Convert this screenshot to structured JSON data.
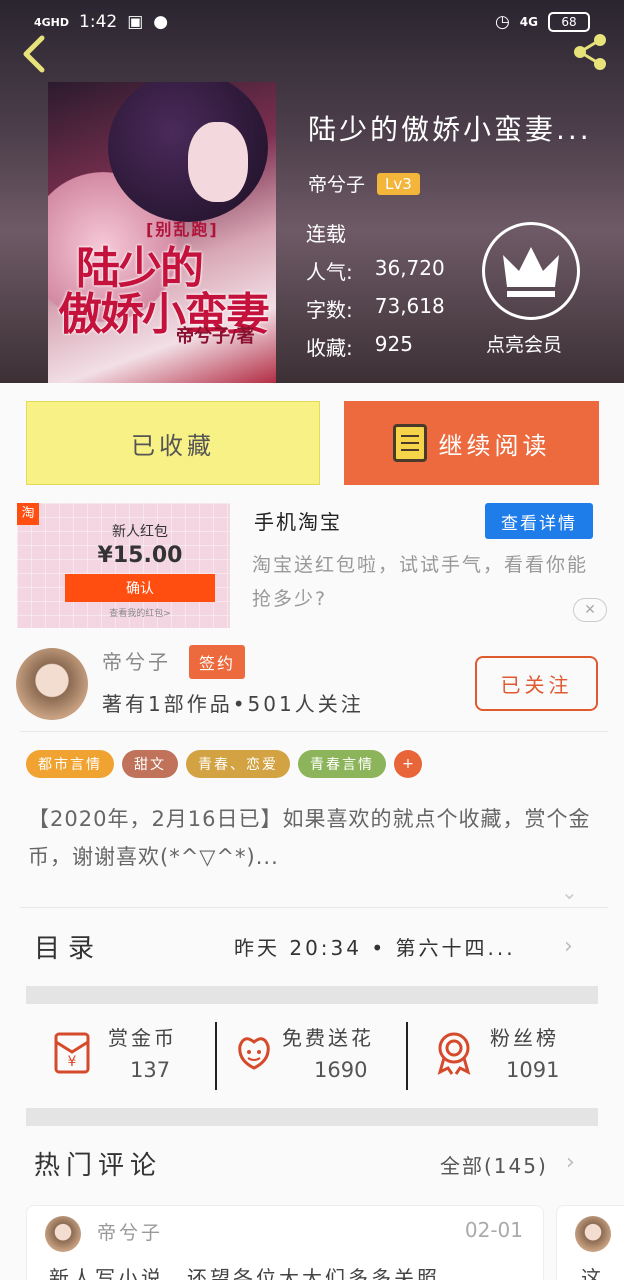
{
  "status_bar": {
    "network": "4GHD",
    "time": "1:42",
    "right_network": "4G",
    "battery": "68"
  },
  "book": {
    "title": "陆少的傲娇小蛮妻...",
    "cover_tag": "[别乱跑]",
    "cover_title_line1": "陆少的",
    "cover_title_line2": "傲娇小蛮妻",
    "cover_author": "帝兮子/著",
    "author": "帝兮子",
    "level": "Lv3",
    "status": "连载",
    "popularity_label": "人气:",
    "popularity_value": "36,720",
    "words_label": "字数:",
    "words_value": "73,618",
    "collect_label": "收藏:",
    "collect_value": "925",
    "member_label": "点亮会员"
  },
  "actions": {
    "collected_label": "已收藏",
    "continue_label": "继续阅读"
  },
  "ad": {
    "logo": "淘",
    "card_label": "新人红包",
    "card_amount": "¥15.00",
    "card_confirm": "确认",
    "card_small": "查看我的红包>",
    "title": "手机淘宝",
    "detail_button": "查看详情",
    "description": "淘宝送红包啦，试试手气，看看你能抢多少?",
    "close": "✕"
  },
  "author_section": {
    "name": "帝兮子",
    "badge": "签约",
    "meta": "著有1部作品•501人关注",
    "follow_button": "已关注"
  },
  "tags": [
    {
      "label": "都市言情",
      "color": "#f0a330"
    },
    {
      "label": "甜文",
      "color": "#c0735a"
    },
    {
      "label": "青春、恋爱",
      "color": "#d2a243"
    },
    {
      "label": "青春言情",
      "color": "#8cb45a"
    }
  ],
  "tag_add": "+",
  "intro": "【2020年，2月16日已】如果喜欢的就点个收藏，赏个金币，谢谢喜欢(*^▽^*)...",
  "catalog": {
    "label": "目录",
    "latest": "昨天 20:34 • 第六十四..."
  },
  "stats": [
    {
      "label": "赏金币",
      "value": "137",
      "icon": "red-envelope-icon"
    },
    {
      "label": "免费送花",
      "value": "1690",
      "icon": "flower-icon"
    },
    {
      "label": "粉丝榜",
      "value": "1091",
      "icon": "medal-icon"
    }
  ],
  "comments": {
    "title": "热门评论",
    "all_label": "全部(145)",
    "items": [
      {
        "name": "帝兮子",
        "date": "02-01",
        "text": "新人写小说，还望各位大大们多多关照"
      },
      {
        "name": "",
        "date": "",
        "text": "这"
      }
    ]
  }
}
